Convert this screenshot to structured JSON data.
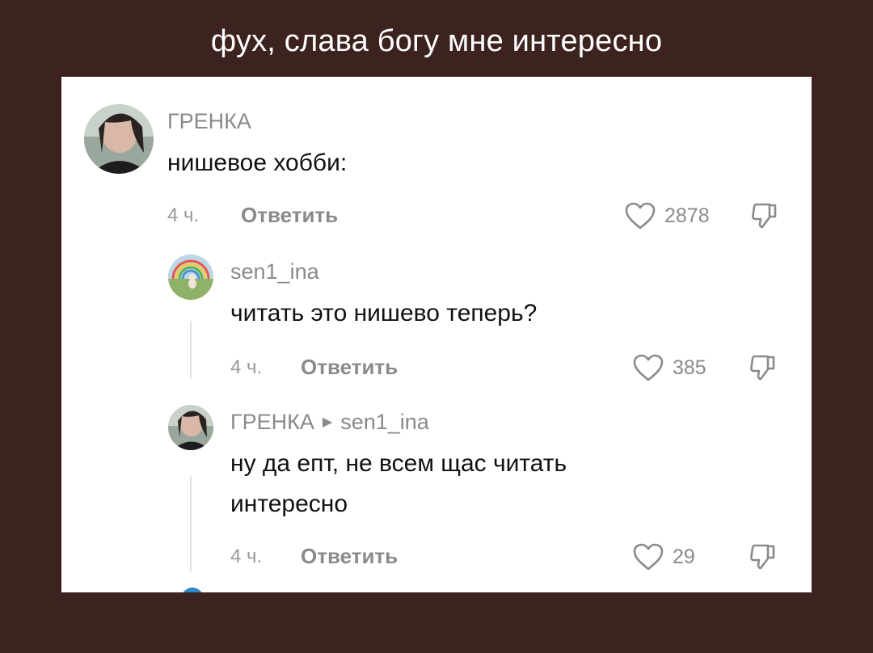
{
  "caption": "фух, слава богу мне интересно",
  "colors": {
    "background": "#3d2320",
    "card": "#ffffff",
    "text": "#111111",
    "meta": "#8a8a8a"
  },
  "comments": [
    {
      "author": "ГРЕНКА",
      "text": "нишевое хобби:",
      "time": "4 ч.",
      "reply_label": "Ответить",
      "likes": "2878"
    },
    {
      "author": "sen1_ina",
      "text": "читать это нишево теперь?",
      "time": "4 ч.",
      "reply_label": "Ответить",
      "likes": "385"
    },
    {
      "author": "ГРЕНКА",
      "reply_to": "sen1_ina",
      "text_line1": "ну да епт, не всем щас читать",
      "text_line2": "интересно",
      "time": "4 ч.",
      "reply_label": "Ответить",
      "likes": "29"
    }
  ],
  "icons": {
    "like": "heart-outline-icon",
    "dislike": "thumbs-down-icon",
    "reply_arrow": "triangle-right-icon"
  }
}
